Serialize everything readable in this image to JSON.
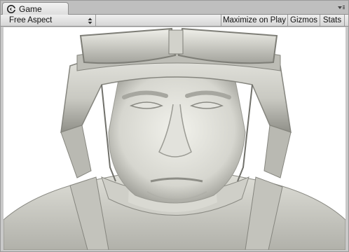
{
  "tab": {
    "label": "Game"
  },
  "toolbar": {
    "aspect_label": "Free Aspect",
    "maximize_label": "Maximize on Play",
    "gizmos_label": "Gizmos",
    "stats_label": "Stats"
  },
  "icons": {
    "tab_icon": "unity-game-icon",
    "panel_menu": "panel-menu-icon",
    "dropdown": "dropdown-arrow-icon"
  },
  "colors": {
    "model_light": "#ececE6",
    "model_shadow": "#8c8c86",
    "background": "#ffffff"
  }
}
